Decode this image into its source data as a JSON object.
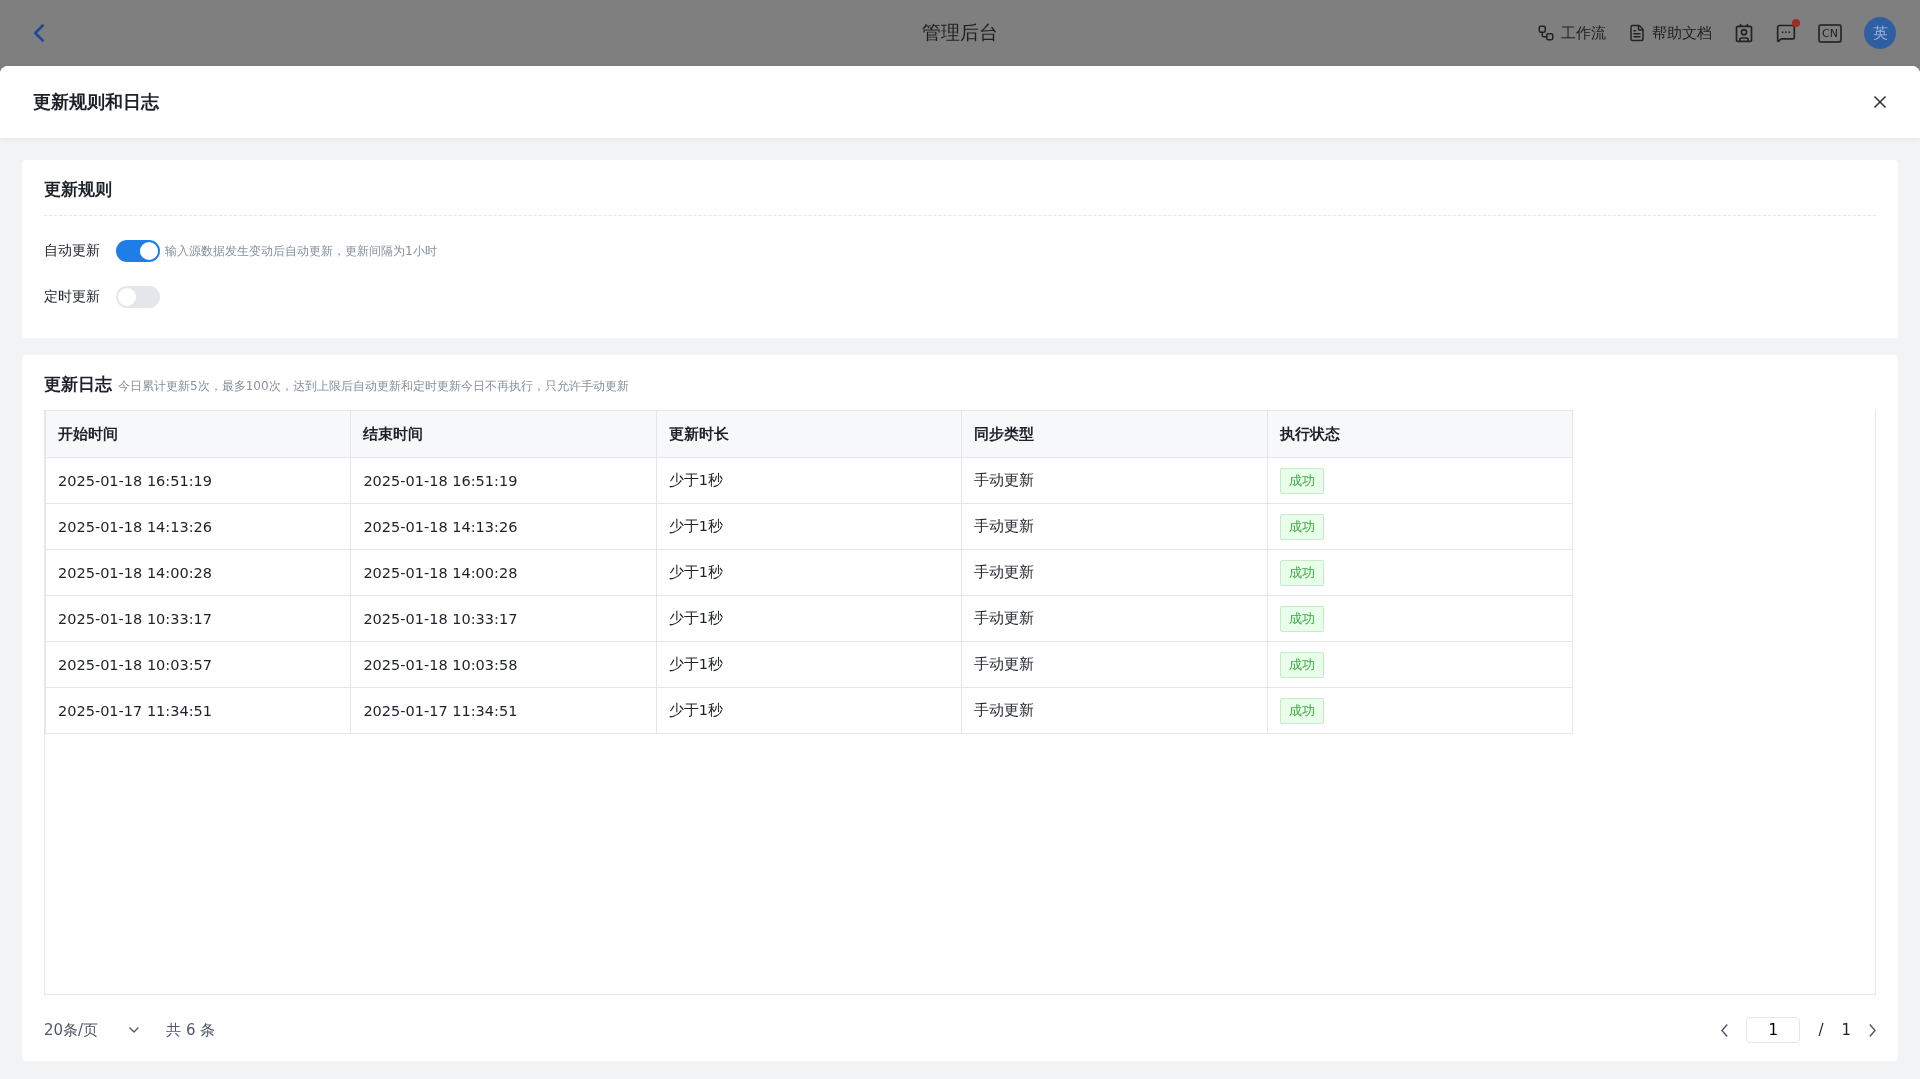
{
  "topbar": {
    "title": "管理后台",
    "links": [
      {
        "kind": "workflow",
        "label": "工作流"
      },
      {
        "kind": "doc",
        "label": "帮助文档"
      }
    ],
    "messages_unread": true,
    "language": "CN",
    "avatar": "英"
  },
  "drawer": {
    "title": "更新规则和日志"
  },
  "rules": {
    "title": "更新规则",
    "items": [
      {
        "label": "自动更新",
        "on": true,
        "hint": "输入源数据发生变动后自动更新，更新间隔为1小时"
      },
      {
        "label": "定时更新",
        "on": false
      }
    ]
  },
  "log": {
    "title": "更新日志",
    "note": "今日累计更新5次，最多100次，达到上限后自动更新和定时更新今日不再执行，只允许手动更新",
    "table": {
      "columns": [
        "开始时间",
        "结束时间",
        "更新时长",
        "同步类型",
        "执行状态"
      ],
      "rows": [
        [
          "2025-01-18 16:51:19",
          "2025-01-18 16:51:19",
          "少于1秒",
          "手动更新",
          "成功"
        ],
        [
          "2025-01-18 14:13:26",
          "2025-01-18 14:13:26",
          "少于1秒",
          "手动更新",
          "成功"
        ],
        [
          "2025-01-18 14:00:28",
          "2025-01-18 14:00:28",
          "少于1秒",
          "手动更新",
          "成功"
        ],
        [
          "2025-01-18 10:33:17",
          "2025-01-18 10:33:17",
          "少于1秒",
          "手动更新",
          "成功"
        ],
        [
          "2025-01-18 10:03:57",
          "2025-01-18 10:03:58",
          "少于1秒",
          "手动更新",
          "成功"
        ],
        [
          "2025-01-17 11:34:51",
          "2025-01-17 11:34:51",
          "少于1秒",
          "手动更新",
          "成功"
        ]
      ]
    },
    "pagination": {
      "page_size": "20条/页",
      "total": "共 6 条",
      "page": "1",
      "separator": "/",
      "pages": "1"
    }
  }
}
